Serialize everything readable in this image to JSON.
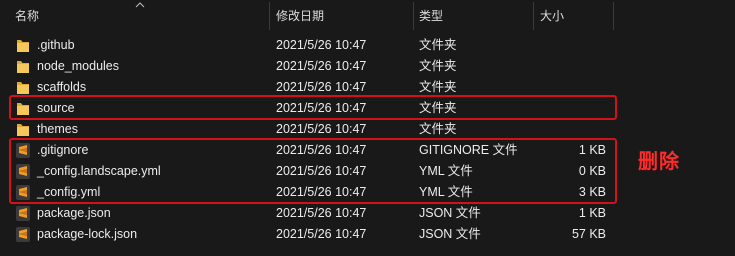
{
  "columns": {
    "name": "名称",
    "date": "修改日期",
    "type": "类型",
    "size": "大小"
  },
  "sort_indicator": "chevron-up-icon",
  "files": [
    {
      "name": ".github",
      "date": "2021/5/26 10:47",
      "type": "文件夹",
      "size": "",
      "icon": "folder-icon"
    },
    {
      "name": "node_modules",
      "date": "2021/5/26 10:47",
      "type": "文件夹",
      "size": "",
      "icon": "folder-icon"
    },
    {
      "name": "scaffolds",
      "date": "2021/5/26 10:47",
      "type": "文件夹",
      "size": "",
      "icon": "folder-icon"
    },
    {
      "name": "source",
      "date": "2021/5/26 10:47",
      "type": "文件夹",
      "size": "",
      "icon": "folder-icon"
    },
    {
      "name": "themes",
      "date": "2021/5/26 10:47",
      "type": "文件夹",
      "size": "",
      "icon": "folder-icon"
    },
    {
      "name": ".gitignore",
      "date": "2021/5/26 10:47",
      "type": "GITIGNORE 文件",
      "size": "1 KB",
      "icon": "sublime-file-icon"
    },
    {
      "name": "_config.landscape.yml",
      "date": "2021/5/26 10:47",
      "type": "YML 文件",
      "size": "0 KB",
      "icon": "sublime-file-icon"
    },
    {
      "name": "_config.yml",
      "date": "2021/5/26 10:47",
      "type": "YML 文件",
      "size": "3 KB",
      "icon": "sublime-file-icon"
    },
    {
      "name": "package.json",
      "date": "2021/5/26 10:47",
      "type": "JSON 文件",
      "size": "1 KB",
      "icon": "sublime-file-icon"
    },
    {
      "name": "package-lock.json",
      "date": "2021/5/26 10:47",
      "type": "JSON 文件",
      "size": "57 KB",
      "icon": "sublime-file-icon"
    }
  ],
  "annotation": "删除",
  "colors": {
    "background": "#191919",
    "highlight_border": "#d0121b",
    "annotation_text": "#ff2a2a",
    "folder": "#f3c14b",
    "sublime_icon": "#f39c1f"
  }
}
